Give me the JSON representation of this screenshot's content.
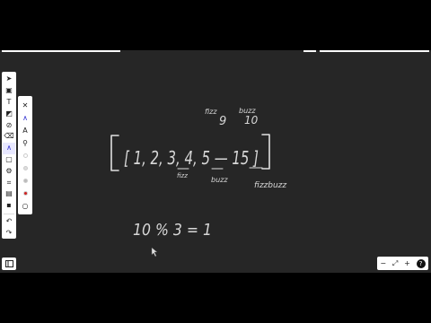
{
  "toolbar": {
    "tools": [
      {
        "name": "select-tool-icon",
        "glyph": "➤"
      },
      {
        "name": "frame-tool-icon",
        "glyph": "▣"
      },
      {
        "name": "text-tool-icon",
        "glyph": "T"
      },
      {
        "name": "note-tool-icon",
        "glyph": "◩"
      },
      {
        "name": "link-tool-icon",
        "glyph": "⊘"
      },
      {
        "name": "eraser-tool-icon",
        "glyph": "⌫"
      },
      {
        "name": "pen-tool-icon",
        "glyph": "∧",
        "active": true
      },
      {
        "name": "shape-tool-icon",
        "glyph": "▢"
      },
      {
        "name": "lasso-tool-icon",
        "glyph": "⚙"
      },
      {
        "name": "crop-tool-icon",
        "glyph": "⌗"
      },
      {
        "name": "image-tool-icon",
        "glyph": "▤"
      },
      {
        "name": "sticker-tool-icon",
        "glyph": "▪"
      },
      {
        "name": "undo-icon",
        "glyph": "↶"
      },
      {
        "name": "redo-icon",
        "glyph": "↷"
      }
    ]
  },
  "pen_panel": {
    "close_glyph": "✕",
    "items": [
      {
        "name": "pen-style-icon",
        "glyph": "∧",
        "active": true
      },
      {
        "name": "marker-style-icon",
        "glyph": "A"
      },
      {
        "name": "highlighter-style-icon",
        "glyph": "⚲"
      },
      {
        "name": "color-swatch-white",
        "color": "#ffffff"
      },
      {
        "name": "color-swatch-light",
        "color": "#dddddd"
      },
      {
        "name": "color-swatch-gray",
        "color": "#bbbbbb"
      },
      {
        "name": "color-swatch-red",
        "color": "#d02020"
      },
      {
        "name": "stroke-size-icon",
        "glyph": "○"
      }
    ]
  },
  "zoom": {
    "minus": "−",
    "fit": "⤢",
    "plus": "+",
    "help": "?"
  },
  "whiteboard": {
    "label_fizz_top": "fizz",
    "label_nine": "9",
    "label_buzz_top": "buzz",
    "label_ten": "10",
    "array_text": "[ 1, 2, 3, 4, 5 — 15 ]",
    "label_fizz_under": "fizz",
    "label_buzz_under": "buzz",
    "label_fizzbuzz": "fizzbuzz",
    "modulo_text": "10 % 3 = 1"
  },
  "colors": {
    "canvas_bg": "#262626",
    "ink": "#e0e0e0",
    "accent": "#3030d0"
  }
}
